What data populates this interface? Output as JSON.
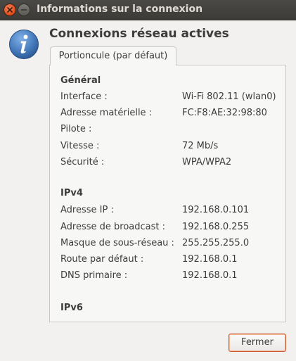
{
  "window": {
    "title": "Informations sur la connexion"
  },
  "heading": "Connexions réseau actives",
  "tab": {
    "label": "Portioncule (par défaut)"
  },
  "general": {
    "title": "Général",
    "rows": [
      {
        "label": "Interface :",
        "value": "Wi-Fi 802.11 (wlan0)"
      },
      {
        "label": "Adresse matérielle :",
        "value": "FC:F8:AE:32:98:80"
      },
      {
        "label": "Pilote :",
        "value": ""
      },
      {
        "label": "Vitesse :",
        "value": "72 Mb/s"
      },
      {
        "label": "Sécurité :",
        "value": "WPA/WPA2"
      }
    ]
  },
  "ipv4": {
    "title": "IPv4",
    "rows": [
      {
        "label": "Adresse IP :",
        "value": "192.168.0.101"
      },
      {
        "label": "Adresse de broadcast :",
        "value": "192.168.0.255"
      },
      {
        "label": "Masque de sous-réseau :",
        "value": "255.255.255.0"
      },
      {
        "label": "Route par défaut :",
        "value": "192.168.0.1"
      },
      {
        "label": "DNS primaire :",
        "value": "192.168.0.1"
      }
    ]
  },
  "ipv6": {
    "title": "IPv6"
  },
  "buttons": {
    "close_label": "Fermer"
  },
  "icons": {
    "close": "close-icon",
    "minimize": "minimize-icon",
    "info": "info-icon"
  },
  "colors": {
    "titlebar": "#3c3b37",
    "close_button": "#df4a16",
    "info_icon": "#4a7fc0",
    "focus_border": "#c8582b"
  }
}
